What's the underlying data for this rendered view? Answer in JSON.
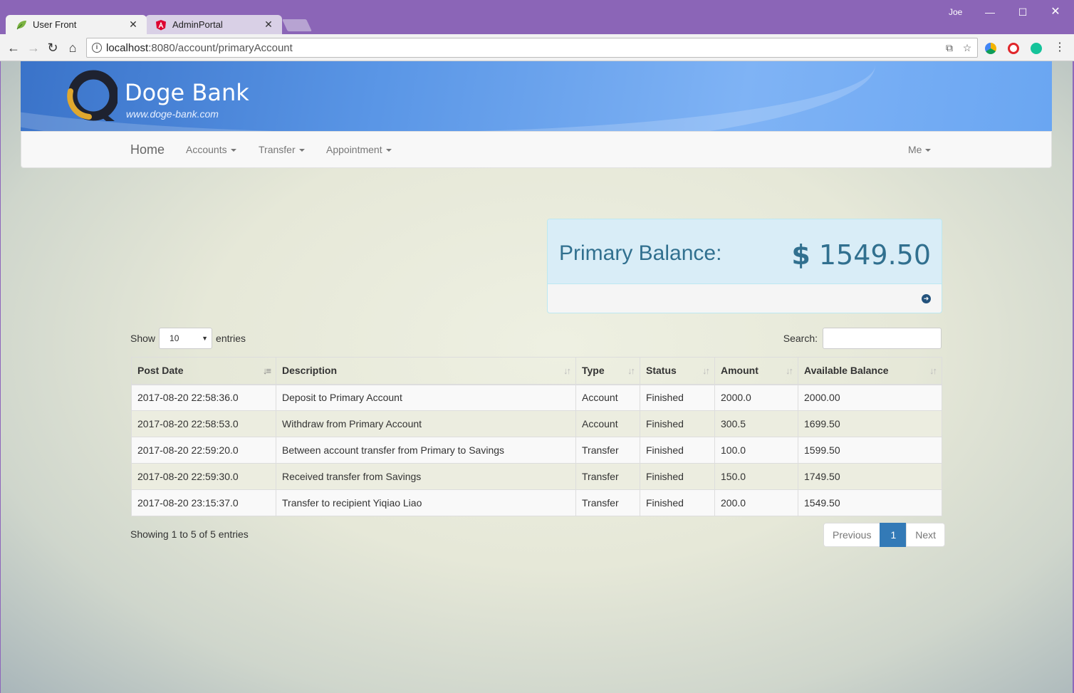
{
  "browser": {
    "tabs": [
      {
        "label": "User Front",
        "favicon": "leaf-icon",
        "close": "✕"
      },
      {
        "label": "AdminPortal",
        "favicon": "angular-icon",
        "close": "✕"
      }
    ],
    "profile": "Joe",
    "url_host": "localhost",
    "url_rest": ":8080/account/primaryAccount"
  },
  "brand": {
    "name": "Doge Bank",
    "url": "www.doge-bank.com"
  },
  "nav": {
    "home": "Home",
    "accounts": "Accounts",
    "transfer": "Transfer",
    "appointment": "Appointment",
    "me": "Me"
  },
  "balance": {
    "label": "Primary Balance:",
    "currency": "$",
    "value": "1549.50"
  },
  "table_controls": {
    "show": "Show",
    "entries_value": "10",
    "entries": "entries",
    "search_label": "Search:"
  },
  "table": {
    "headers": [
      "Post Date",
      "Description",
      "Type",
      "Status",
      "Amount",
      "Available Balance"
    ],
    "rows": [
      [
        "2017-08-20 22:58:36.0",
        "Deposit to Primary Account",
        "Account",
        "Finished",
        "2000.0",
        "2000.00"
      ],
      [
        "2017-08-20 22:58:53.0",
        "Withdraw from Primary Account",
        "Account",
        "Finished",
        "300.5",
        "1699.50"
      ],
      [
        "2017-08-20 22:59:20.0",
        "Between account transfer from Primary to Savings",
        "Transfer",
        "Finished",
        "100.0",
        "1599.50"
      ],
      [
        "2017-08-20 22:59:30.0",
        "Received transfer from Savings",
        "Transfer",
        "Finished",
        "150.0",
        "1749.50"
      ],
      [
        "2017-08-20 23:15:37.0",
        "Transfer to recipient Yiqiao Liao",
        "Transfer",
        "Finished",
        "200.0",
        "1549.50"
      ]
    ]
  },
  "footer": {
    "info": "Showing 1 to 5 of 5 entries",
    "previous": "Previous",
    "page": "1",
    "next": "Next"
  },
  "colors": {
    "accent": "#337ab7",
    "panel_info": "#d9edf7",
    "titlebar": "#8b65b7"
  }
}
